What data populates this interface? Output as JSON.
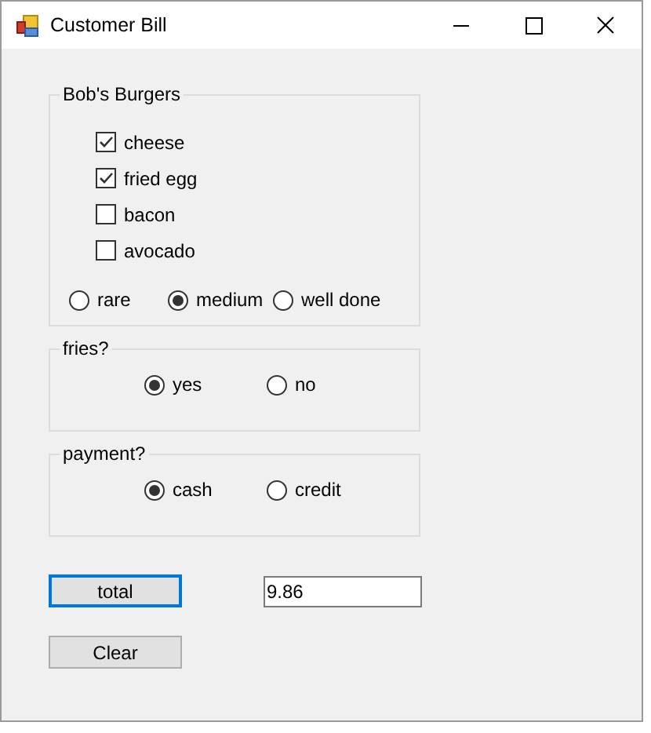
{
  "window": {
    "title": "Customer Bill"
  },
  "burger_group": {
    "title": "Bob's Burgers",
    "toppings": [
      {
        "label": "cheese",
        "checked": true
      },
      {
        "label": "fried egg",
        "checked": true
      },
      {
        "label": "bacon",
        "checked": false
      },
      {
        "label": "avocado",
        "checked": false
      }
    ],
    "doneness": [
      {
        "label": "rare",
        "selected": false
      },
      {
        "label": "medium",
        "selected": true
      },
      {
        "label": "well done",
        "selected": false
      }
    ]
  },
  "fries_group": {
    "title": "fries?",
    "options": [
      {
        "label": "yes",
        "selected": true
      },
      {
        "label": "no",
        "selected": false
      }
    ]
  },
  "payment_group": {
    "title": "payment?",
    "options": [
      {
        "label": "cash",
        "selected": true
      },
      {
        "label": "credit",
        "selected": false
      }
    ]
  },
  "total_button": {
    "label": "total",
    "focused": true
  },
  "total_field": {
    "value": "9.86"
  },
  "clear_button": {
    "label": "Clear"
  }
}
